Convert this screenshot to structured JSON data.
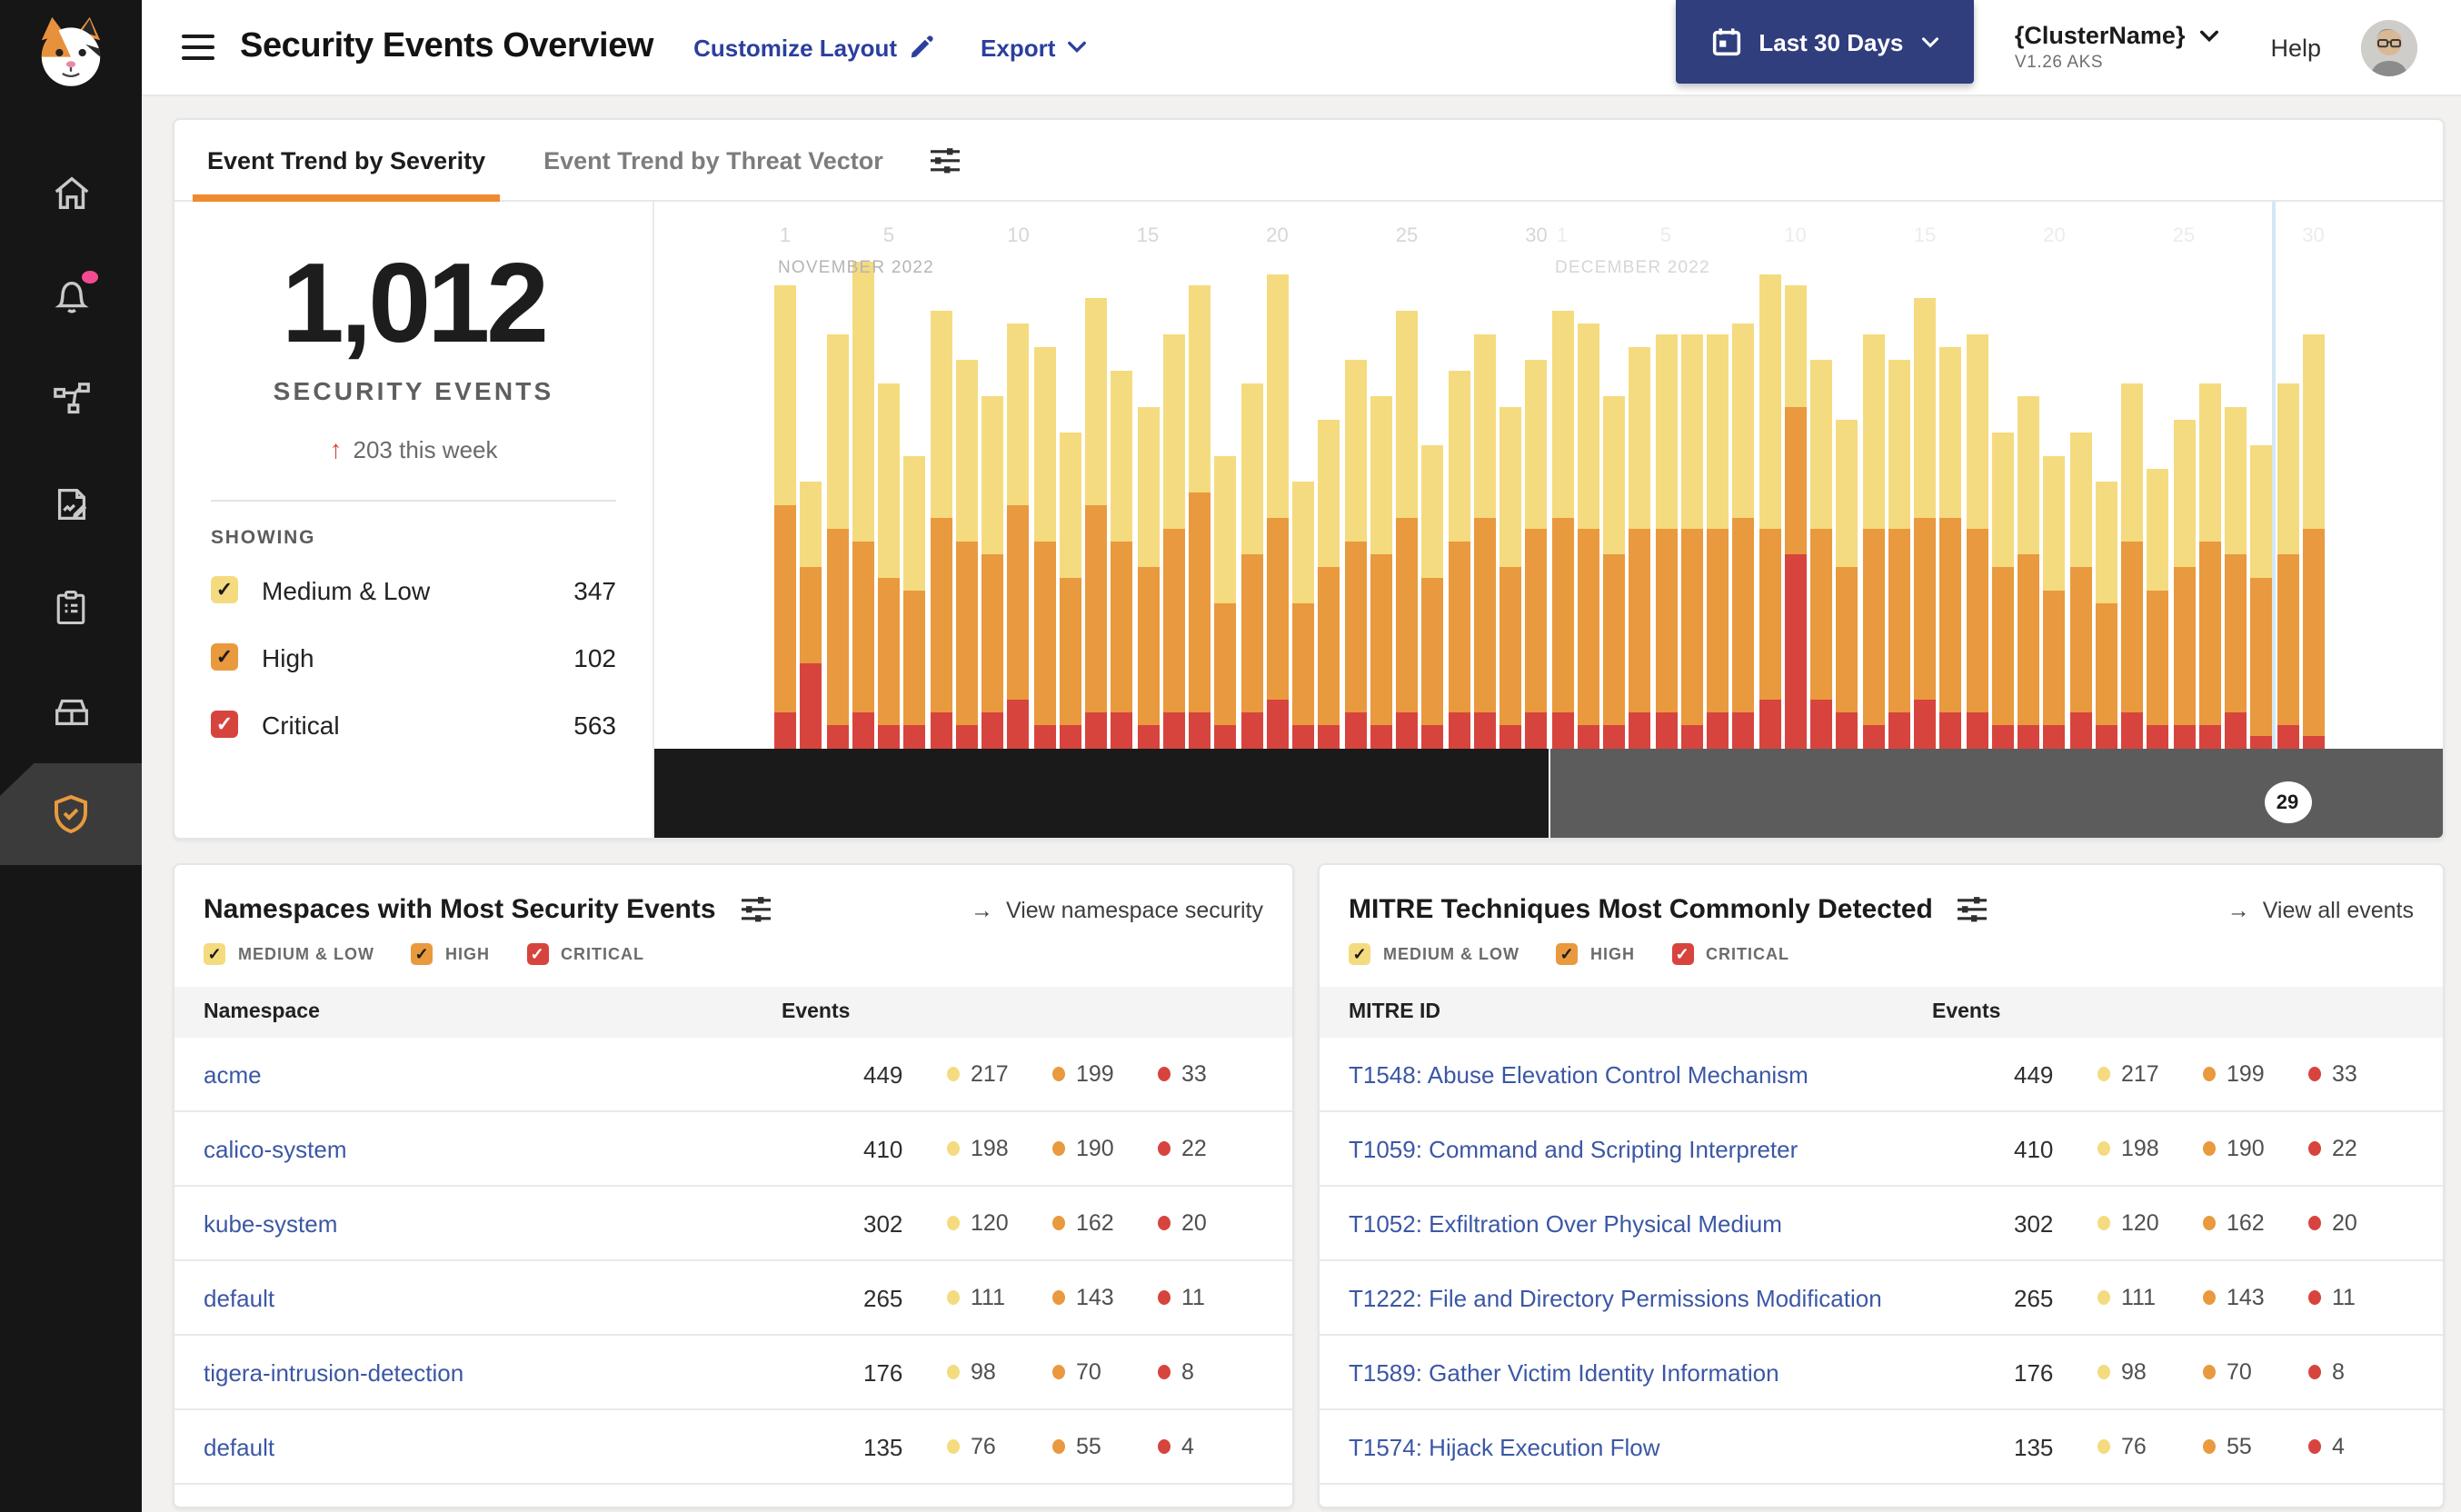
{
  "header": {
    "title": "Security Events Overview",
    "customize_label": "Customize Layout",
    "export_label": "Export",
    "date_range": "Last 30 Days",
    "cluster_name": "{ClusterName}",
    "cluster_version": "V1.26 AKS",
    "help_label": "Help"
  },
  "severity_colors": {
    "medium_low": "#f5db7f",
    "high": "#e9993e",
    "critical": "#d7443e"
  },
  "chips": [
    {
      "key": "medium_low",
      "label": "MEDIUM & LOW"
    },
    {
      "key": "high",
      "label": "HIGH"
    },
    {
      "key": "critical",
      "label": "CRITICAL"
    }
  ],
  "trend": {
    "tabs": [
      "Event Trend by Severity",
      "Event Trend by Threat Vector"
    ],
    "summary": {
      "total": "1,012",
      "label": "SECURITY EVENTS",
      "delta_arrow": "↑",
      "delta": "203 this week"
    },
    "showing": {
      "label": "SHOWING",
      "items": [
        {
          "key": "medium_low",
          "label": "Medium & Low",
          "count": "347",
          "checked": true
        },
        {
          "key": "high",
          "label": "High",
          "count": "102",
          "checked": true
        },
        {
          "key": "critical",
          "label": "Critical",
          "count": "563",
          "checked": true
        }
      ]
    }
  },
  "chart_data": {
    "type": "bar",
    "stacked": true,
    "ylim": [
      0,
      40
    ],
    "x_months": [
      {
        "label": "NOVEMBER 2022",
        "days": 30,
        "ticks": [
          1,
          5,
          10,
          15,
          20,
          25,
          30
        ]
      },
      {
        "label": "DECEMBER 2022",
        "days": 30,
        "ticks": [
          1,
          5,
          10,
          15,
          20,
          25,
          30
        ]
      }
    ],
    "selected_day": {
      "month": "DECEMBER 2022",
      "day": "29"
    },
    "series": [
      {
        "name": "Critical",
        "color": "#d7443e",
        "values": [
          3,
          7,
          2,
          3,
          2,
          2,
          3,
          2,
          3,
          4,
          2,
          2,
          3,
          3,
          2,
          3,
          3,
          2,
          3,
          4,
          2,
          2,
          3,
          2,
          3,
          2,
          3,
          3,
          2,
          3,
          3,
          2,
          2,
          3,
          3,
          2,
          3,
          3,
          4,
          16,
          4,
          3,
          2,
          3,
          4,
          3,
          3,
          2,
          2,
          2,
          3,
          2,
          3,
          2,
          2,
          2,
          3,
          1,
          2,
          1
        ]
      },
      {
        "name": "High",
        "color": "#e9993e",
        "values": [
          17,
          8,
          16,
          14,
          12,
          11,
          16,
          15,
          13,
          16,
          15,
          12,
          17,
          14,
          13,
          15,
          18,
          10,
          13,
          15,
          10,
          13,
          14,
          14,
          16,
          12,
          14,
          16,
          13,
          15,
          16,
          16,
          14,
          15,
          15,
          16,
          15,
          16,
          14,
          12,
          14,
          12,
          16,
          15,
          15,
          16,
          15,
          13,
          14,
          11,
          12,
          10,
          14,
          11,
          13,
          15,
          13,
          13,
          14,
          17
        ]
      },
      {
        "name": "Medium & Low",
        "color": "#f5db7f",
        "values": [
          18,
          7,
          16,
          23,
          16,
          11,
          17,
          15,
          13,
          15,
          16,
          12,
          17,
          14,
          13,
          16,
          17,
          12,
          14,
          20,
          10,
          12,
          15,
          13,
          17,
          11,
          14,
          15,
          13,
          14,
          17,
          17,
          13,
          15,
          16,
          16,
          16,
          16,
          21,
          10,
          14,
          12,
          16,
          14,
          18,
          14,
          16,
          11,
          13,
          11,
          11,
          10,
          13,
          10,
          12,
          13,
          12,
          11,
          14,
          16
        ]
      }
    ]
  },
  "namespaces_card": {
    "title": "Namespaces with Most Security Events",
    "link_arrow": "→",
    "link": "View namespace security",
    "columns": [
      "Namespace",
      "Events"
    ],
    "rows": [
      {
        "name": "acme",
        "total": "449",
        "medium_low": "217",
        "high": "199",
        "critical": "33"
      },
      {
        "name": "calico-system",
        "total": "410",
        "medium_low": "198",
        "high": "190",
        "critical": "22"
      },
      {
        "name": "kube-system",
        "total": "302",
        "medium_low": "120",
        "high": "162",
        "critical": "20"
      },
      {
        "name": "default",
        "total": "265",
        "medium_low": "111",
        "high": "143",
        "critical": "11"
      },
      {
        "name": "tigera-intrusion-detection",
        "total": "176",
        "medium_low": "98",
        "high": "70",
        "critical": "8"
      },
      {
        "name": "default",
        "total": "135",
        "medium_low": "76",
        "high": "55",
        "critical": "4"
      }
    ]
  },
  "mitre_card": {
    "title": "MITRE Techniques Most Commonly Detected",
    "link_arrow": "→",
    "link": "View all events",
    "columns": [
      "MITRE ID",
      "Events"
    ],
    "rows": [
      {
        "name": "T1548: Abuse Elevation Control Mechanism",
        "total": "449",
        "medium_low": "217",
        "high": "199",
        "critical": "33"
      },
      {
        "name": "T1059: Command and Scripting Interpreter",
        "total": "410",
        "medium_low": "198",
        "high": "190",
        "critical": "22"
      },
      {
        "name": "T1052: Exfiltration Over Physical Medium",
        "total": "302",
        "medium_low": "120",
        "high": "162",
        "critical": "20"
      },
      {
        "name": "T1222: File and Directory Permissions Modification",
        "total": "265",
        "medium_low": "111",
        "high": "143",
        "critical": "11"
      },
      {
        "name": "T1589: Gather Victim Identity Information",
        "total": "176",
        "medium_low": "98",
        "high": "70",
        "critical": "8"
      },
      {
        "name": "T1574: Hijack Execution Flow",
        "total": "135",
        "medium_low": "76",
        "high": "55",
        "critical": "4"
      }
    ]
  }
}
